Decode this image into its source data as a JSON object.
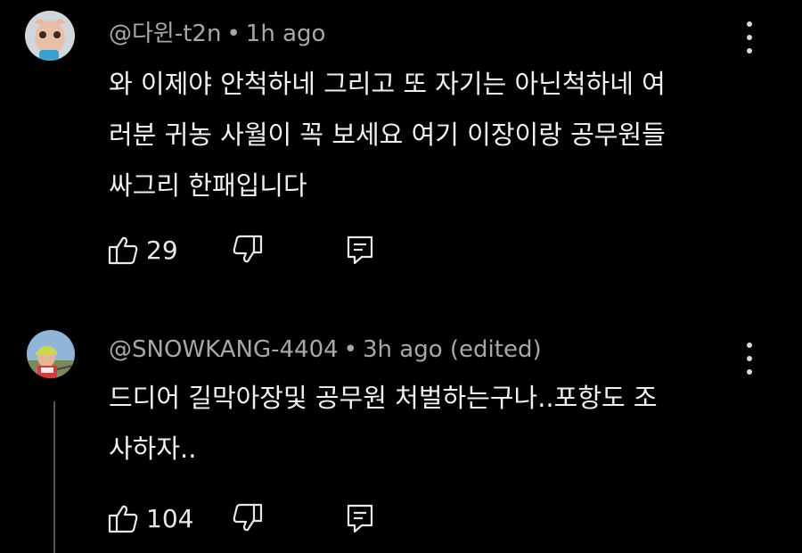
{
  "comments": [
    {
      "author": "@다윈-t2n",
      "separator": "•",
      "time": "1h ago",
      "text_lines": [
        "와 이제야 안척하네 그리고 또 자기는 아닌척하네 여",
        "러분 귀농 사월이 꼭 보세요 여기 이장이랑 공무원들",
        "싸그리 한패입니다"
      ],
      "likes": "29",
      "icons": {
        "like": "thumbs-up-icon",
        "dislike": "thumbs-down-icon",
        "reply": "reply-icon",
        "more": "more-vertical-icon"
      }
    },
    {
      "author": "@SNOWKANG-4404",
      "separator": "•",
      "time": "3h ago (edited)",
      "text_lines": [
        "드디어 길막아장및 공무원 처벌하는구나..포항도 조",
        "사하자.."
      ],
      "likes": "104",
      "icons": {
        "like": "thumbs-up-icon",
        "dislike": "thumbs-down-icon",
        "reply": "reply-icon",
        "more": "more-vertical-icon"
      }
    }
  ],
  "colors": {
    "background": "#000000",
    "meta": "#a8a8a8",
    "text": "#f1f1f1"
  }
}
